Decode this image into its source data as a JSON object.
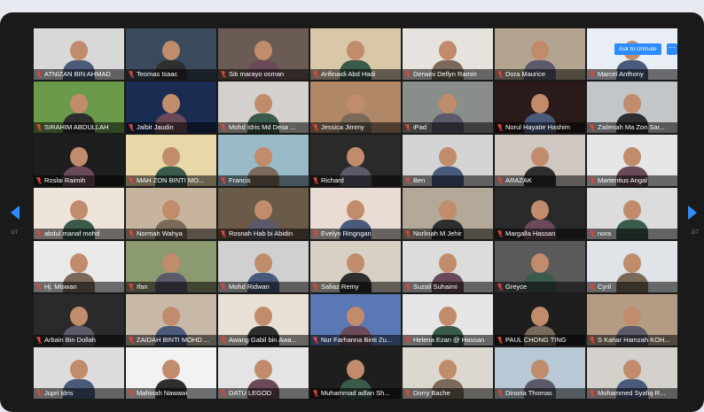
{
  "nav": {
    "prev_page": "1/7",
    "next_page": "2/7"
  },
  "overlay": {
    "ask_unmute": "Ask to Unmute",
    "more": "···"
  },
  "colors": {
    "muted_mic": "#e0453a",
    "accent": "#2d8cff"
  },
  "participants": [
    {
      "name": "ATNIZAN BIN AHMAD",
      "bg": "#d8d8d8"
    },
    {
      "name": "Teomas Isaac",
      "bg": "#3a4a5c"
    },
    {
      "name": "Siti marayo osman",
      "bg": "#6a5c54"
    },
    {
      "name": "Arifinaidi Abd Hadi",
      "bg": "#d9c8a8"
    },
    {
      "name": "Derwini Dellyn Ramin",
      "bg": "#e6e3de"
    },
    {
      "name": "Dora Maurice",
      "bg": "#b2a48e"
    },
    {
      "name": "Marcel Anthony",
      "bg": "#e8eef4"
    },
    {
      "name": "SIRAHIM ABDULLAH",
      "bg": "#6a9a4a"
    },
    {
      "name": "Jalbit Jaudin",
      "bg": "#1b2c52"
    },
    {
      "name": "Mohd Idris Md Desa ...",
      "bg": "#d4d0cc"
    },
    {
      "name": "Jessica Jimmy",
      "bg": "#b08868"
    },
    {
      "name": "iPad",
      "bg": "#8a8e8a"
    },
    {
      "name": "Norul Hayatie Hashim",
      "bg": "#2a1a1a"
    },
    {
      "name": "Zailenah Ma Zon Sar...",
      "bg": "#c2c6c8"
    },
    {
      "name": "Roslai Raimih",
      "bg": "#1e1e1e"
    },
    {
      "name": "MAH ZON BINTI MO...",
      "bg": "#e8d8a8"
    },
    {
      "name": "Francis",
      "bg": "#9abac8"
    },
    {
      "name": "Richard",
      "bg": "#2a2a2a"
    },
    {
      "name": "Ben",
      "bg": "#d4d4d4"
    },
    {
      "name": "ARAZAK",
      "bg": "#cfc8c2"
    },
    {
      "name": "Martentius Angal",
      "bg": "#e6e6e6"
    },
    {
      "name": "abdul manaf mohd",
      "bg": "#ede4da"
    },
    {
      "name": "Normah Wahya",
      "bg": "#c6b49c"
    },
    {
      "name": "Rosnah Hab bi Abidin",
      "bg": "#6a5a48"
    },
    {
      "name": "Evelyn Ringngan",
      "bg": "#e8dcd4"
    },
    {
      "name": "Norlinah M Jehir",
      "bg": "#b4a898"
    },
    {
      "name": "Margalla Hassan",
      "bg": "#2a2a2a"
    },
    {
      "name": "nora",
      "bg": "#dcdcdc"
    },
    {
      "name": "Hj. Miswan",
      "bg": "#eaeaea"
    },
    {
      "name": "Ifan",
      "bg": "#8c9a70"
    },
    {
      "name": "Mohd Ridwan",
      "bg": "#d0d0d0"
    },
    {
      "name": "Safiaz Remy",
      "bg": "#d8d0c4"
    },
    {
      "name": "Suzali Suhaimi",
      "bg": "#dcdcdc"
    },
    {
      "name": "Greyce",
      "bg": "#5a5a5a"
    },
    {
      "name": "Cyril",
      "bg": "#e0e4e8"
    },
    {
      "name": "Arbain Bin Dollah",
      "bg": "#2a2a2a"
    },
    {
      "name": "ZAIDAH BINTI MOHD ...",
      "bg": "#c8b8a8"
    },
    {
      "name": "Awang Gabil bin Awa...",
      "bg": "#e8e0d4"
    },
    {
      "name": "Nur Farhanna Binti Zu...",
      "bg": "#5a78b4"
    },
    {
      "name": "Helena Ezan @ Hassan",
      "bg": "#e6e6e6"
    },
    {
      "name": "PAUL CHONG TING",
      "bg": "#1e1e1e"
    },
    {
      "name": "S Kahar Hamzah KOH...",
      "bg": "#b49c84"
    },
    {
      "name": "Jupri Idris",
      "bg": "#dcdcdc"
    },
    {
      "name": "Mahinah Nawawi",
      "bg": "#f2f2f2"
    },
    {
      "name": "DATU LEGOD",
      "bg": "#e4e4e4"
    },
    {
      "name": "Muhammad adlan Sh...",
      "bg": "#1e1e1e"
    },
    {
      "name": "Dorry Bache",
      "bg": "#dcd8d0"
    },
    {
      "name": "Dinoria Thomas",
      "bg": "#b8c8d4"
    },
    {
      "name": "Mohammed Syafiq R...",
      "bg": "#d4d0cc"
    }
  ]
}
